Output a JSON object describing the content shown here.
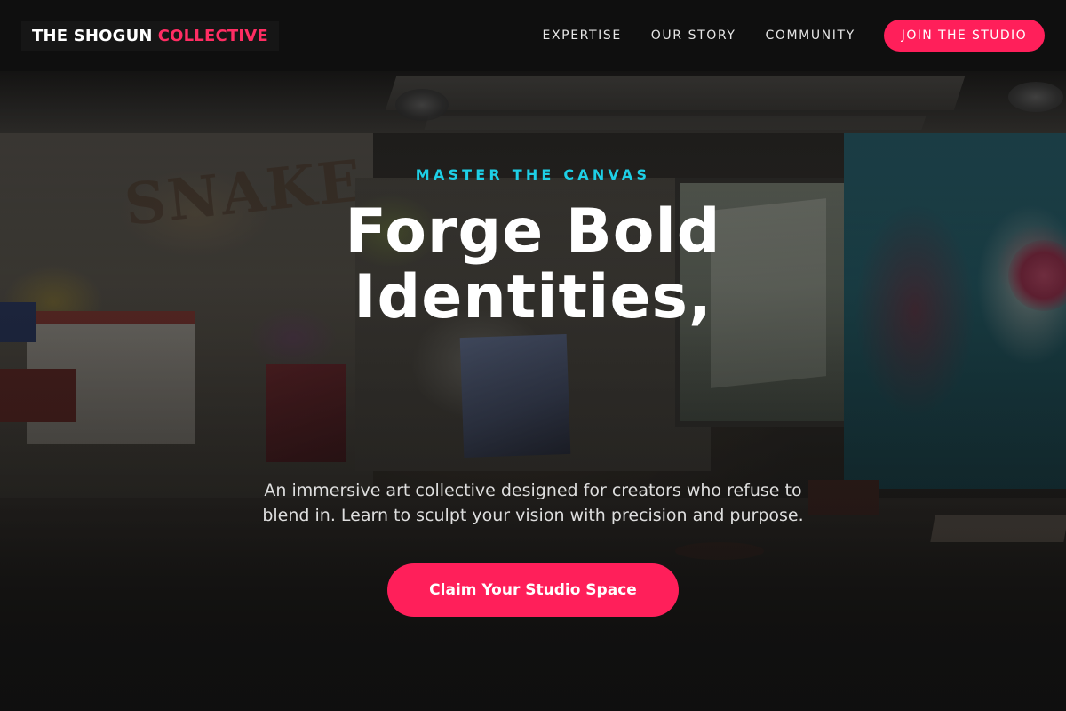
{
  "nav": {
    "brand_primary": "THE SHOGUN",
    "brand_accent": "COLLECTIVE",
    "links": [
      {
        "label": "EXPERTISE"
      },
      {
        "label": "OUR STORY"
      },
      {
        "label": "COMMUNITY"
      }
    ],
    "cta_label": "JOIN THE STUDIO"
  },
  "hero": {
    "eyebrow": "MASTER THE CANVAS",
    "headline_line1": "Forge Bold",
    "headline_line2": "Identities,",
    "subtext_line1": "An immersive art collective designed for creators who refuse to",
    "subtext_line2": "blend in. Learn to sculpt your vision with precision and purpose.",
    "cta_label": "Claim Your Studio Space",
    "background_image": "graffiti-art-studio-photo"
  },
  "colors": {
    "accent_pink": "#ff1f5a",
    "accent_cyan": "#1ecfe6",
    "nav_background": "#0f0f0f"
  }
}
